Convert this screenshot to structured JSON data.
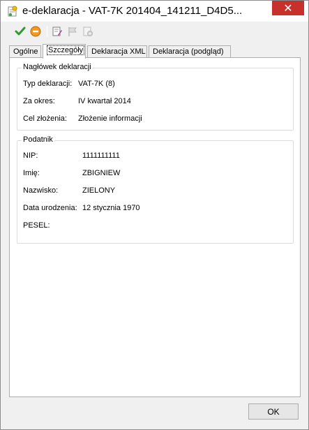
{
  "window": {
    "title": "e-deklaracja - VAT-7K 201404_141211_D4D5...",
    "close_glyph": "✕"
  },
  "toolbar": {
    "icons": [
      "checkmark-icon",
      "cancel-icon",
      "edit-document-icon",
      "flag-icon",
      "settings-document-icon"
    ]
  },
  "tabs": [
    "Ogólne",
    "Szczegóły",
    "Deklaracja XML",
    "Deklaracja (podgląd)"
  ],
  "header_group": {
    "title": "Nagłówek deklaracji",
    "rows": [
      {
        "label": "Typ deklaracji:",
        "value": "VAT-7K (8)"
      },
      {
        "label": "Za okres:",
        "value": "IV kwartał 2014"
      },
      {
        "label": "Cel złożenia:",
        "value": "Złożenie informacji"
      }
    ]
  },
  "taxpayer_group": {
    "title": "Podatnik",
    "rows": [
      {
        "label": "NIP:",
        "value": "1111111111"
      },
      {
        "label": "Imię:",
        "value": "ZBIGNIEW"
      },
      {
        "label": "Nazwisko:",
        "value": "ZIELONY"
      },
      {
        "label": "Data urodzenia:",
        "value": "12 stycznia 1970"
      },
      {
        "label": "PESEL:",
        "value": ""
      }
    ]
  },
  "footer": {
    "ok_label": "OK"
  }
}
